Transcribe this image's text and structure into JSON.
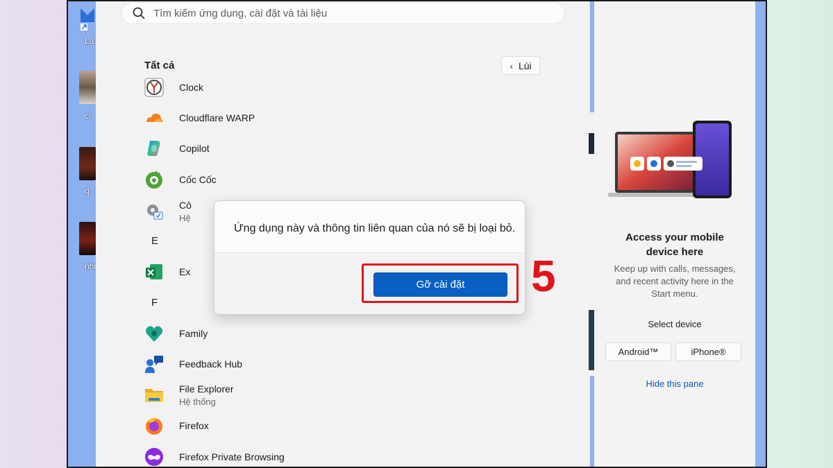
{
  "search": {
    "placeholder": "Tìm kiếm ứng dụng, cài đặt và tài liệu"
  },
  "all_apps": {
    "title": "Tất cả",
    "back_label": "Lùi",
    "items": [
      {
        "name": "Clock",
        "icon": "clock-icon"
      },
      {
        "name": "Cloudflare WARP",
        "icon": "cloudflare-icon"
      },
      {
        "name": "Copilot",
        "icon": "copilot-icon"
      },
      {
        "name": "Cốc Cốc",
        "icon": "coccoc-icon"
      },
      {
        "name": "Cô",
        "sub": "Hệ",
        "icon": "settings-tool-icon"
      },
      {
        "name": "Ex",
        "icon": "excel-icon"
      },
      {
        "name": "Family",
        "icon": "family-icon"
      },
      {
        "name": "Feedback Hub",
        "icon": "feedback-hub-icon"
      },
      {
        "name": "File Explorer",
        "sub": "Hệ thống",
        "icon": "folder-icon"
      },
      {
        "name": "Firefox",
        "icon": "firefox-icon"
      },
      {
        "name": "Firefox Private Browsing",
        "icon": "firefox-private-icon"
      }
    ],
    "letters": [
      "E",
      "F"
    ]
  },
  "dialog": {
    "message": "Ứng dụng này và thông tin liên quan của nó sẽ bị loại bỏ.",
    "uninstall_label": "Gỡ cài đặt"
  },
  "annotation": {
    "step": "5",
    "color": "#e0141b"
  },
  "phone_panel": {
    "title_line1": "Access your mobile",
    "title_line2": "device here",
    "desc_line1": "Keep up with calls, messages,",
    "desc_line2": "and recent activity here in the",
    "desc_line3": "Start menu.",
    "select_label": "Select device",
    "android_label": "Android™",
    "iphone_label": "iPhone®",
    "hide_label": "Hide this pane"
  },
  "desktop": {
    "labels": [
      "La",
      "ci",
      "q",
      "nhm"
    ]
  },
  "colors": {
    "accent": "#0a5fc2",
    "link": "#0b57b0",
    "annotation": "#e0141b"
  }
}
